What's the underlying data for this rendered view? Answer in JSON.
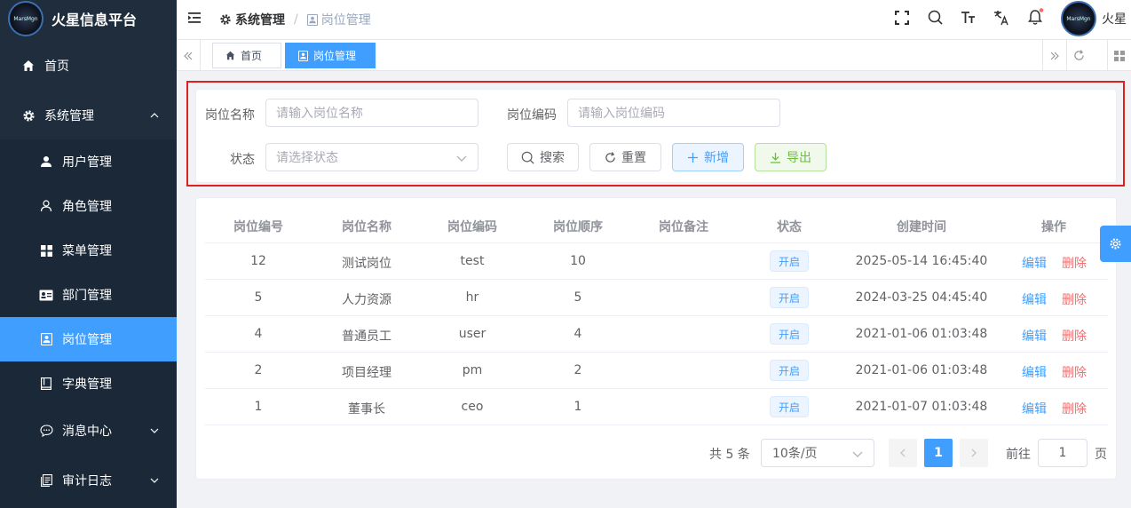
{
  "app": {
    "title": "火星信息平台",
    "logo_text": "MarsMgn"
  },
  "sidebar": {
    "items": [
      {
        "label": "首页",
        "icon": "home-icon"
      },
      {
        "label": "系统管理",
        "icon": "gear-icon",
        "expanded": true
      },
      {
        "label": "用户管理",
        "icon": "user-icon"
      },
      {
        "label": "角色管理",
        "icon": "person-outline-icon"
      },
      {
        "label": "菜单管理",
        "icon": "grid-icon"
      },
      {
        "label": "部门管理",
        "icon": "id-card-icon"
      },
      {
        "label": "岗位管理",
        "icon": "post-icon",
        "active": true
      },
      {
        "label": "字典管理",
        "icon": "book-icon"
      },
      {
        "label": "消息中心",
        "icon": "chat-icon"
      },
      {
        "label": "审计日志",
        "icon": "log-icon"
      }
    ]
  },
  "header": {
    "breadcrumb": [
      "系统管理",
      "岗位管理"
    ],
    "user_name": "火星",
    "icons": [
      "fullscreen-icon",
      "search-icon",
      "font-size-icon",
      "translate-icon",
      "bell-icon"
    ]
  },
  "tags": {
    "items": [
      {
        "label": "首页",
        "active": false
      },
      {
        "label": "岗位管理",
        "active": true
      }
    ]
  },
  "search": {
    "post_name_label": "岗位名称",
    "post_name_placeholder": "请输入岗位名称",
    "post_code_label": "岗位编码",
    "post_code_placeholder": "请输入岗位编码",
    "status_label": "状态",
    "status_placeholder": "请选择状态",
    "search_btn": "搜索",
    "reset_btn": "重置",
    "add_btn": "新增",
    "export_btn": "导出"
  },
  "table": {
    "headers": [
      "岗位编号",
      "岗位名称",
      "岗位编码",
      "岗位顺序",
      "岗位备注",
      "状态",
      "创建时间",
      "操作"
    ],
    "rows": [
      {
        "id": "12",
        "name": "测试岗位",
        "code": "test",
        "order": "10",
        "remark": "",
        "status": "开启",
        "created": "2025-05-14 16:45:40"
      },
      {
        "id": "5",
        "name": "人力资源",
        "code": "hr",
        "order": "5",
        "remark": "",
        "status": "开启",
        "created": "2024-03-25 04:45:40"
      },
      {
        "id": "4",
        "name": "普通员工",
        "code": "user",
        "order": "4",
        "remark": "",
        "status": "开启",
        "created": "2021-01-06 01:03:48"
      },
      {
        "id": "2",
        "name": "项目经理",
        "code": "pm",
        "order": "2",
        "remark": "",
        "status": "开启",
        "created": "2021-01-06 01:03:48"
      },
      {
        "id": "1",
        "name": "董事长",
        "code": "ceo",
        "order": "1",
        "remark": "",
        "status": "开启",
        "created": "2021-01-07 01:03:48"
      }
    ],
    "edit_label": "编辑",
    "delete_label": "删除"
  },
  "pagination": {
    "total_text": "共 5 条",
    "page_size": "10条/页",
    "current_page": "1",
    "goto_label": "前往",
    "goto_value": "1",
    "page_suffix": "页"
  },
  "colors": {
    "primary": "#409eff",
    "danger": "#f56c6c",
    "success": "#67c23a",
    "sidebar_bg": "#1f2d3d"
  }
}
